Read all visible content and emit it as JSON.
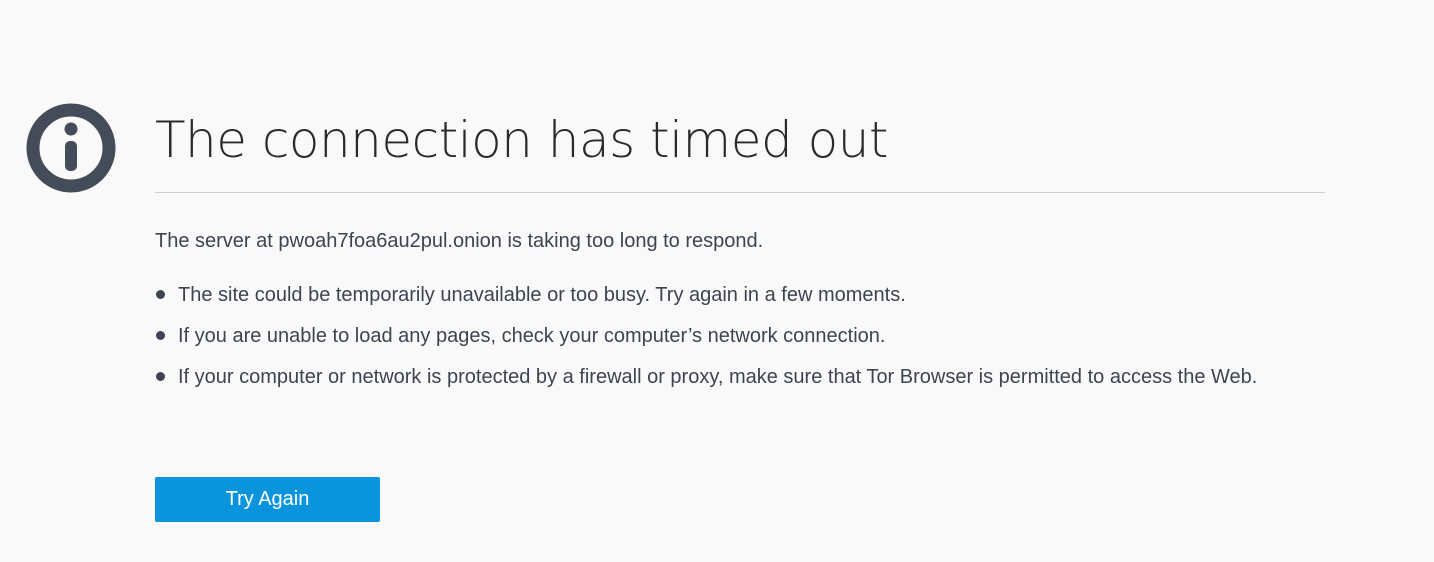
{
  "page": {
    "title": "The connection has timed out",
    "description": "The server at pwoah7foa6au2pul.onion is taking too long to respond.",
    "icon": "info-icon"
  },
  "suggestions": [
    "The site could be temporarily unavailable or too busy. Try again in a few moments.",
    "If you are unable to load any pages, check your computer’s network connection.",
    "If your computer or network is protected by a firewall or proxy, make sure that Tor Browser is permitted to access the Web."
  ],
  "actions": {
    "try_again_label": "Try Again"
  },
  "colors": {
    "background": "#f9f9fa",
    "text": "#3d4450",
    "icon": "#434c58",
    "button": "#0a94dc",
    "divider": "#cdcdd1"
  }
}
